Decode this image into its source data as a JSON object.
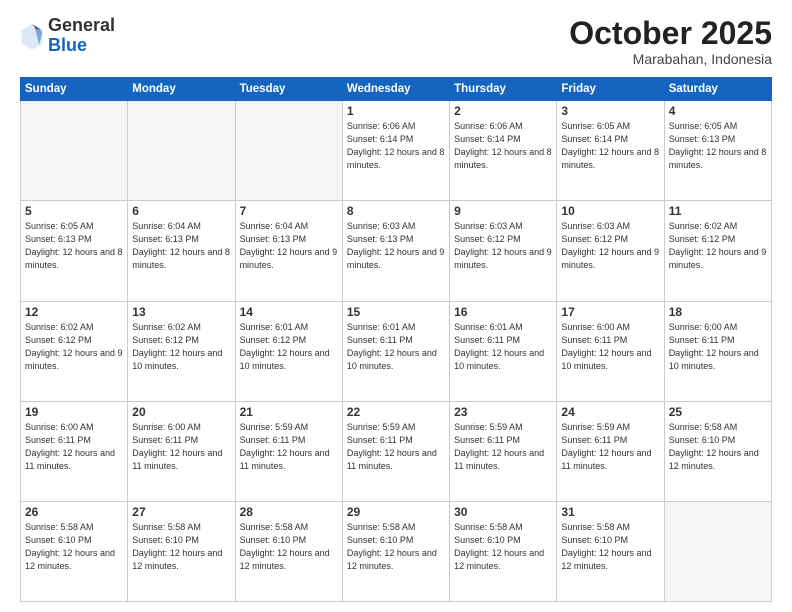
{
  "header": {
    "logo": {
      "general": "General",
      "blue": "Blue"
    },
    "title": "October 2025",
    "location": "Marabahan, Indonesia"
  },
  "weekdays": [
    "Sunday",
    "Monday",
    "Tuesday",
    "Wednesday",
    "Thursday",
    "Friday",
    "Saturday"
  ],
  "weeks": [
    [
      {
        "day": "",
        "info": ""
      },
      {
        "day": "",
        "info": ""
      },
      {
        "day": "",
        "info": ""
      },
      {
        "day": "1",
        "info": "Sunrise: 6:06 AM\nSunset: 6:14 PM\nDaylight: 12 hours\nand 8 minutes."
      },
      {
        "day": "2",
        "info": "Sunrise: 6:06 AM\nSunset: 6:14 PM\nDaylight: 12 hours\nand 8 minutes."
      },
      {
        "day": "3",
        "info": "Sunrise: 6:05 AM\nSunset: 6:14 PM\nDaylight: 12 hours\nand 8 minutes."
      },
      {
        "day": "4",
        "info": "Sunrise: 6:05 AM\nSunset: 6:13 PM\nDaylight: 12 hours\nand 8 minutes."
      }
    ],
    [
      {
        "day": "5",
        "info": "Sunrise: 6:05 AM\nSunset: 6:13 PM\nDaylight: 12 hours\nand 8 minutes."
      },
      {
        "day": "6",
        "info": "Sunrise: 6:04 AM\nSunset: 6:13 PM\nDaylight: 12 hours\nand 8 minutes."
      },
      {
        "day": "7",
        "info": "Sunrise: 6:04 AM\nSunset: 6:13 PM\nDaylight: 12 hours\nand 9 minutes."
      },
      {
        "day": "8",
        "info": "Sunrise: 6:03 AM\nSunset: 6:13 PM\nDaylight: 12 hours\nand 9 minutes."
      },
      {
        "day": "9",
        "info": "Sunrise: 6:03 AM\nSunset: 6:12 PM\nDaylight: 12 hours\nand 9 minutes."
      },
      {
        "day": "10",
        "info": "Sunrise: 6:03 AM\nSunset: 6:12 PM\nDaylight: 12 hours\nand 9 minutes."
      },
      {
        "day": "11",
        "info": "Sunrise: 6:02 AM\nSunset: 6:12 PM\nDaylight: 12 hours\nand 9 minutes."
      }
    ],
    [
      {
        "day": "12",
        "info": "Sunrise: 6:02 AM\nSunset: 6:12 PM\nDaylight: 12 hours\nand 9 minutes."
      },
      {
        "day": "13",
        "info": "Sunrise: 6:02 AM\nSunset: 6:12 PM\nDaylight: 12 hours\nand 10 minutes."
      },
      {
        "day": "14",
        "info": "Sunrise: 6:01 AM\nSunset: 6:12 PM\nDaylight: 12 hours\nand 10 minutes."
      },
      {
        "day": "15",
        "info": "Sunrise: 6:01 AM\nSunset: 6:11 PM\nDaylight: 12 hours\nand 10 minutes."
      },
      {
        "day": "16",
        "info": "Sunrise: 6:01 AM\nSunset: 6:11 PM\nDaylight: 12 hours\nand 10 minutes."
      },
      {
        "day": "17",
        "info": "Sunrise: 6:00 AM\nSunset: 6:11 PM\nDaylight: 12 hours\nand 10 minutes."
      },
      {
        "day": "18",
        "info": "Sunrise: 6:00 AM\nSunset: 6:11 PM\nDaylight: 12 hours\nand 10 minutes."
      }
    ],
    [
      {
        "day": "19",
        "info": "Sunrise: 6:00 AM\nSunset: 6:11 PM\nDaylight: 12 hours\nand 11 minutes."
      },
      {
        "day": "20",
        "info": "Sunrise: 6:00 AM\nSunset: 6:11 PM\nDaylight: 12 hours\nand 11 minutes."
      },
      {
        "day": "21",
        "info": "Sunrise: 5:59 AM\nSunset: 6:11 PM\nDaylight: 12 hours\nand 11 minutes."
      },
      {
        "day": "22",
        "info": "Sunrise: 5:59 AM\nSunset: 6:11 PM\nDaylight: 12 hours\nand 11 minutes."
      },
      {
        "day": "23",
        "info": "Sunrise: 5:59 AM\nSunset: 6:11 PM\nDaylight: 12 hours\nand 11 minutes."
      },
      {
        "day": "24",
        "info": "Sunrise: 5:59 AM\nSunset: 6:11 PM\nDaylight: 12 hours\nand 11 minutes."
      },
      {
        "day": "25",
        "info": "Sunrise: 5:58 AM\nSunset: 6:10 PM\nDaylight: 12 hours\nand 12 minutes."
      }
    ],
    [
      {
        "day": "26",
        "info": "Sunrise: 5:58 AM\nSunset: 6:10 PM\nDaylight: 12 hours\nand 12 minutes."
      },
      {
        "day": "27",
        "info": "Sunrise: 5:58 AM\nSunset: 6:10 PM\nDaylight: 12 hours\nand 12 minutes."
      },
      {
        "day": "28",
        "info": "Sunrise: 5:58 AM\nSunset: 6:10 PM\nDaylight: 12 hours\nand 12 minutes."
      },
      {
        "day": "29",
        "info": "Sunrise: 5:58 AM\nSunset: 6:10 PM\nDaylight: 12 hours\nand 12 minutes."
      },
      {
        "day": "30",
        "info": "Sunrise: 5:58 AM\nSunset: 6:10 PM\nDaylight: 12 hours\nand 12 minutes."
      },
      {
        "day": "31",
        "info": "Sunrise: 5:58 AM\nSunset: 6:10 PM\nDaylight: 12 hours\nand 12 minutes."
      },
      {
        "day": "",
        "info": ""
      }
    ]
  ]
}
